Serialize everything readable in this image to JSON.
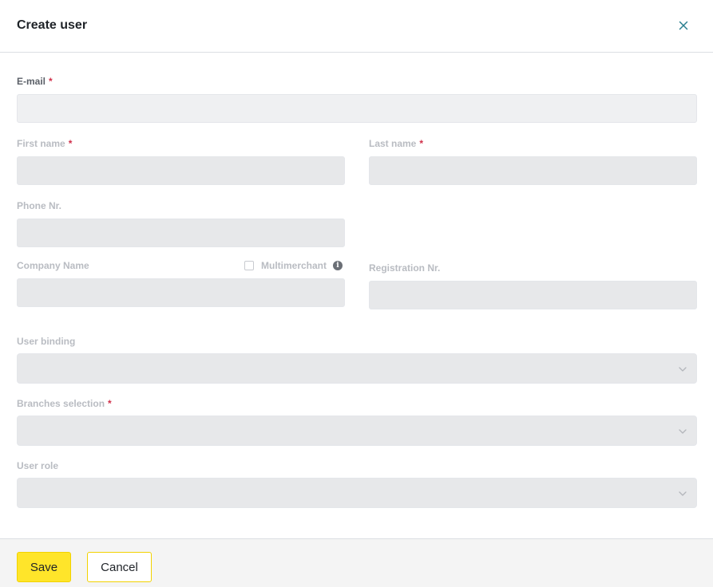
{
  "dialog": {
    "title": "Create user"
  },
  "form": {
    "required_marker": "*",
    "email": {
      "label": "E-mail",
      "value": "",
      "required": true
    },
    "first_name": {
      "label": "First name",
      "value": "",
      "required": true
    },
    "last_name": {
      "label": "Last name",
      "value": "",
      "required": true
    },
    "phone": {
      "label": "Phone Nr.",
      "value": ""
    },
    "company_name": {
      "label": "Company Name",
      "value": ""
    },
    "multimerchant": {
      "label": "Multimerchant",
      "checked": false
    },
    "registration": {
      "label": "Registration Nr.",
      "value": ""
    },
    "user_binding": {
      "label": "User binding",
      "selected": ""
    },
    "branches": {
      "label": "Branches selection",
      "selected": "",
      "required": true
    },
    "user_role": {
      "label": "User role",
      "selected": ""
    }
  },
  "footer": {
    "save_label": "Save",
    "cancel_label": "Cancel"
  },
  "icons": {
    "close": "close-icon",
    "info": "info-icon",
    "chevron": "chevron-down-icon",
    "info_glyph": "i"
  },
  "colors": {
    "accent_yellow": "#ffe52a",
    "required_red": "#d0304a",
    "close_icon": "#2a7f8f"
  }
}
